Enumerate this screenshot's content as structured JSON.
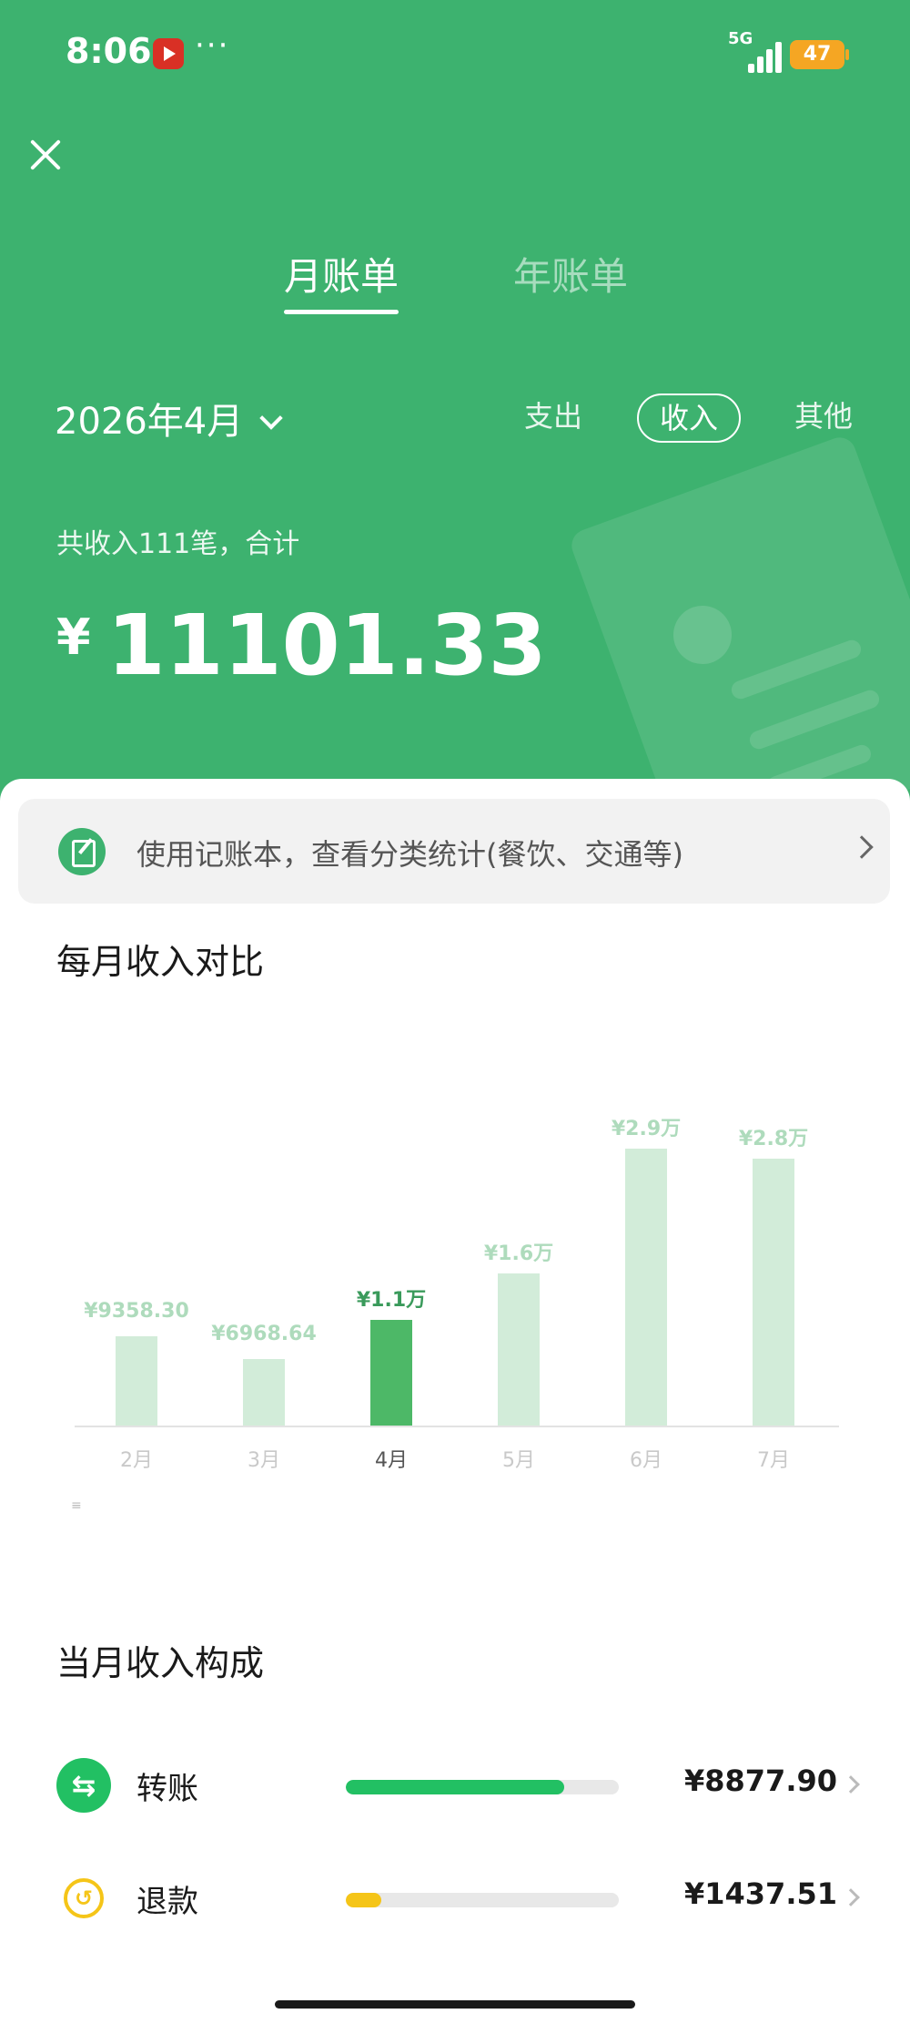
{
  "status_bar": {
    "time": "8:06",
    "dots": "···",
    "network": "5G",
    "battery": "47"
  },
  "tabs": [
    {
      "label": "月账单",
      "active": true
    },
    {
      "label": "年账单",
      "active": false
    }
  ],
  "filter": {
    "month": "2026年4月",
    "types": [
      {
        "label": "支出",
        "active": false
      },
      {
        "label": "收入",
        "active": true
      },
      {
        "label": "其他",
        "active": false
      }
    ]
  },
  "summary": {
    "label": "共收入111笔，合计",
    "currency": "¥",
    "amount": "11101.33"
  },
  "banner": {
    "text": "使用记账本，查看分类统计(餐饮、交通等)"
  },
  "monthly_compare": {
    "title": "每月收入对比"
  },
  "chart_data": {
    "type": "bar",
    "categories": [
      "2月",
      "3月",
      "4月",
      "5月",
      "6月",
      "7月"
    ],
    "values": [
      9358.3,
      6968.64,
      11101.33,
      16000,
      29000,
      28000
    ],
    "data_labels": [
      "¥9358.30",
      "¥6968.64",
      "¥1.1万",
      "¥1.6万",
      "¥2.9万",
      "¥2.8万"
    ],
    "highlight_index": 2,
    "ylim": [
      0,
      30000
    ],
    "grid": false,
    "colors": {
      "bar": "#d2ecd9",
      "highlight": "#4db867",
      "label": "#aedbbc",
      "highlight_label": "#3a9a5b"
    }
  },
  "composition": {
    "title": "当月收入构成",
    "items": [
      {
        "label": "转账",
        "amount": "¥8877.90",
        "fraction": 0.8,
        "color": "#22c063",
        "icon": "transfer-icon"
      },
      {
        "label": "退款",
        "amount": "¥1437.51",
        "fraction": 0.13,
        "color": "#f5c518",
        "icon": "refund-icon"
      }
    ]
  },
  "colors": {
    "header_green": "#3db26f",
    "accent_green": "#22c063",
    "refund_yellow": "#f5c518"
  }
}
